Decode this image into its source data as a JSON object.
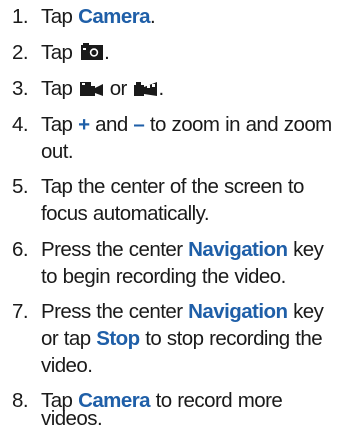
{
  "steps": [
    {
      "num": "1.",
      "t1": "Tap ",
      "kw": "Camera",
      "t2": "."
    },
    {
      "num": "2.",
      "t1": "Tap ",
      "icon": "camera-mode-icon",
      "t2": "."
    },
    {
      "num": "3.",
      "t1": "Tap ",
      "icon1": "video-mode-icon",
      "mid": " or ",
      "icon2": "video-mode-alt-icon",
      "t2": "."
    },
    {
      "num": "4.",
      "t1": "Tap ",
      "plus": "+",
      "mid": " and ",
      "minus": "–",
      "t2": " to zoom in and zoom",
      "t3": "out."
    },
    {
      "num": "5.",
      "line1": "Tap the center of the screen to",
      "line2": "focus automatically."
    },
    {
      "num": "6.",
      "t1": "Press the center ",
      "kw": "Navigation",
      "t2": " key",
      "line2": "to begin recording the video."
    },
    {
      "num": "7.",
      "t1": "Press the center ",
      "kw": "Navigation",
      "t2": " key",
      "l2a": "or tap ",
      "kw2": "Stop",
      "l2b": " to stop recording the",
      "line3": "video."
    },
    {
      "num": "8.",
      "t1": "Tap ",
      "kw": "Camera",
      "t2": " to record more",
      "line2": "videos."
    }
  ],
  "colors": {
    "keyword": "#1f5fa8",
    "text": "#1a1a1a"
  }
}
